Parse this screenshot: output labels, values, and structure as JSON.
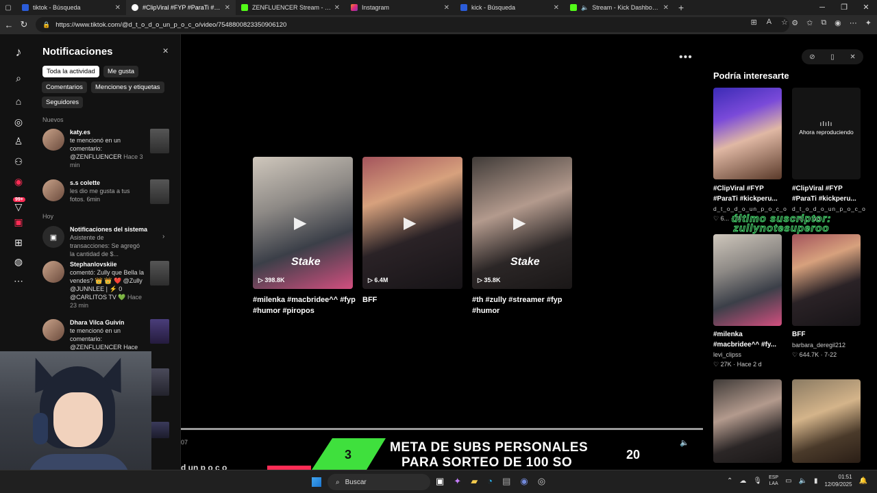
{
  "browser": {
    "tabs": [
      {
        "title": "tiktok - Búsqueda",
        "color": "#2b5cd9",
        "active": false
      },
      {
        "title": "#ClipViral #FYP #ParaTi #kickperu",
        "color": "#ffffff",
        "active": true
      },
      {
        "title": "ZENFLUENCER Stream - Watch Li",
        "color": "#53fc18",
        "active": false
      },
      {
        "title": "Instagram",
        "color": "#e1306c",
        "active": false
      },
      {
        "title": "kick - Búsqueda",
        "color": "#2b5cd9",
        "active": false
      },
      {
        "title": "Stream - Kick Dashboard",
        "color": "#53fc18",
        "active": false
      }
    ],
    "url": "https://www.tiktok.com/@d_t_o_d_o_un_p_o_c_o/video/7548800823350906120"
  },
  "notifications": {
    "title": "Notificaciones",
    "filters": [
      "Toda la actividad",
      "Me gusta",
      "Comentarios",
      "Menciones y etiquetas",
      "Seguidores"
    ],
    "section_new": "Nuevos",
    "section_today": "Hoy",
    "items": [
      {
        "name": "katy.es",
        "text": "te mencionó en un comentario: @ZENFLUENCER",
        "time": "Hace 3 min"
      },
      {
        "name": "s.s colette",
        "text": "les dio me gusta a tus fotos.",
        "time": "6min"
      },
      {
        "name": "Notificaciones del sistema",
        "text": "Asistente de transacciones: Se agregó la cantidad de $..."
      },
      {
        "name": "Stephanlovskiie",
        "text": "comentó: Zully que Bella la vendes? 👑 👑 ❤️ @Zully @JUNNLEE | ⚡ 0 @CARLITOS TV 💚",
        "time": "Hace 23 min"
      },
      {
        "name": "Dhara Vilca Guivín",
        "text": "te mencionó en un comentario: @ZENFLUENCER Hace"
      }
    ]
  },
  "rail": {
    "badge": "99+"
  },
  "videos": [
    {
      "caption": "#milenka #macbridee^^ #fyp #humor #piropos",
      "views": "398.8K"
    },
    {
      "caption": "BFF",
      "views": "6.4M"
    },
    {
      "caption": "#th #zully #streamer #fyp #humor",
      "views": "35.8K"
    }
  ],
  "player": {
    "time_fragment": "07",
    "stake": "Stake"
  },
  "recommendations": {
    "title": "Podría interesarte",
    "now_playing": "Ahora reproduciendo",
    "cards": [
      {
        "caption": "#ClipViral #FYP #ParaTi #kickperu...",
        "author": "d_t_o_d_o_un_p_o_c_o",
        "meta": "♡ 6... · 18"
      },
      {
        "caption": "#ClipViral #FYP #ParaTi #kickperu...",
        "author": "d_t_o_d_o_un_p_o_c_o",
        "meta": "♡ 8... · 18"
      },
      {
        "caption": "#milenka #macbridee^^ #fy...",
        "author": "levi_clipss",
        "meta": "♡ 27K · Hace 2 d"
      },
      {
        "caption": "BFF",
        "author": "barbara_deregil212",
        "meta": "♡ 644.7K · 7-22"
      }
    ]
  },
  "overlay_text": "último suscriptor: zullynotesuperoo",
  "banner": {
    "left_number": "3",
    "line1": "META DE SUBS PERSONALES",
    "line2": "PARA SORTEO DE 100 SO",
    "right_number": "20",
    "fragment": "d un p o c o"
  },
  "taskbar": {
    "search": "Buscar",
    "lang": "ESP",
    "lang2": "LAA",
    "time": "01:51",
    "date": "12/09/2025"
  }
}
